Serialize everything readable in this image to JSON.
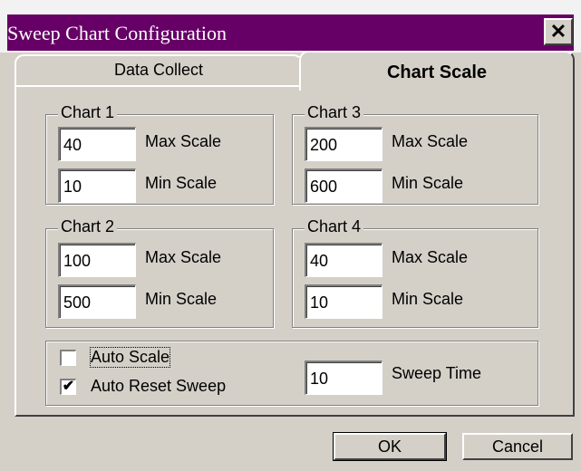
{
  "window": {
    "title": "Sweep Chart Configuration",
    "close_glyph": "✕"
  },
  "tabs": [
    {
      "label": "Data Collect",
      "active": false
    },
    {
      "label": "Chart Scale",
      "active": true
    }
  ],
  "charts": [
    {
      "label": "Chart 1",
      "max_value": "40",
      "min_value": "10",
      "max_label": "Max Scale",
      "min_label": "Min Scale"
    },
    {
      "label": "Chart 2",
      "max_value": "100",
      "min_value": "500",
      "max_label": "Max Scale",
      "min_label": "Min Scale"
    },
    {
      "label": "Chart 3",
      "max_value": "200",
      "min_value": "600",
      "max_label": "Max Scale",
      "min_label": "Min Scale"
    },
    {
      "label": "Chart 4",
      "max_value": "40",
      "min_value": "10",
      "max_label": "Max Scale",
      "min_label": "Min Scale"
    }
  ],
  "options": {
    "auto_scale": {
      "label": "Auto Scale",
      "checked": false
    },
    "auto_reset_sweep": {
      "label": "Auto Reset Sweep",
      "checked": true,
      "mark": "✔"
    },
    "sweep_time": {
      "value": "10",
      "label": "Sweep Time"
    }
  },
  "buttons": {
    "ok": "OK",
    "cancel": "Cancel"
  },
  "colors": {
    "titlebar": "#660066",
    "face": "#d4d0c8"
  }
}
